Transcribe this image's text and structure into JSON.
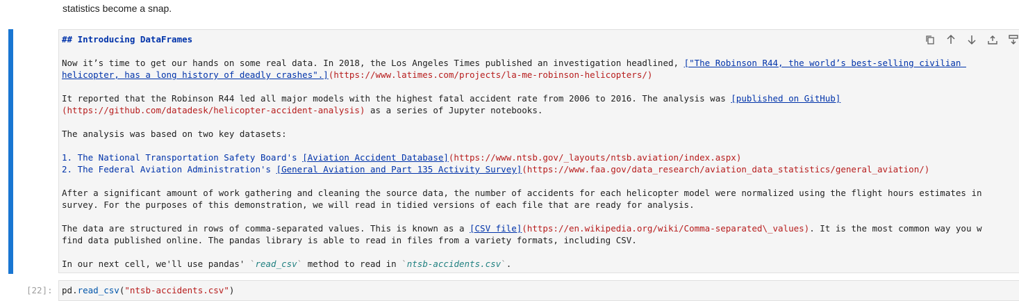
{
  "prev_cell": {
    "text": "statistics become a snap."
  },
  "markdown_cell": {
    "heading": "## Introducing DataFrames",
    "p1": {
      "pre": "Now it’s time to get our hands on some real data. In 2018, the Los Angeles Times published an investigation headlined, ",
      "link1": "[\"The Robinson R44, the world’s best-selling civilian ",
      "link2": "helicopter, has a long history of deadly crashes\".]",
      "url": "(https://www.latimes.com/projects/la-me-robinson-helicopters/)"
    },
    "p2": {
      "pre": "It reported that the Robinson R44 led all major models with the highest fatal accident rate from 2006 to 2016. The analysis was ",
      "link": "[published on GitHub]",
      "url": "(https://github.com/datadesk/helicopter-accident-analysis)",
      "post": " as a series of Jupyter notebooks."
    },
    "p3": "The analysis was based on two key datasets:",
    "list": [
      {
        "pre": "1. The National Transportation Safety Board's ",
        "link": "[Aviation Accident Database]",
        "url": "(https://www.ntsb.gov/_layouts/ntsb.aviation/index.aspx)"
      },
      {
        "pre": "2. The Federal Aviation Administration's ",
        "link": "[General Aviation and Part 135 Activity Survey]",
        "url": "(https://www.faa.gov/data_research/aviation_data_statistics/general_aviation/)"
      }
    ],
    "p4": {
      "line1": "After a significant amount of work gathering and cleaning the source data, the number of accidents for each helicopter model were normalized using the flight hours estimates in",
      "line2": "survey. For the purposes of this demonstration, we will read in tidied versions of each file that are ready for analysis."
    },
    "p5": {
      "pre": "The data are structured in rows of comma-separated values. This is known as a ",
      "link": "[CSV file]",
      "url": "(https://en.wikipedia.org/wiki/Comma-separated\\_values)",
      "post": ". It is the most common way you w",
      "line2": "find data published online. The pandas library is able to read in files from a variety formats, including CSV."
    },
    "p6": {
      "pre": "In our next cell, we'll use pandas' ",
      "code1": "read_csv",
      "mid": " method to read in ",
      "code2": "ntsb-accidents.csv",
      "post": "."
    }
  },
  "toolbar": {
    "icons": [
      "copy-icon",
      "move-up-icon",
      "move-down-icon",
      "insert-above-icon",
      "insert-below-icon"
    ]
  },
  "code_cell": {
    "prompt": "[22]:",
    "obj": "pd",
    "dot": ".",
    "fn": "read_csv",
    "open": "(",
    "arg": "\"ntsb-accidents.csv\"",
    "close": ")"
  },
  "colors": {
    "accent": "#1976d2",
    "link": "#0033aa",
    "url": "#b71c1c",
    "code": "#208080"
  }
}
